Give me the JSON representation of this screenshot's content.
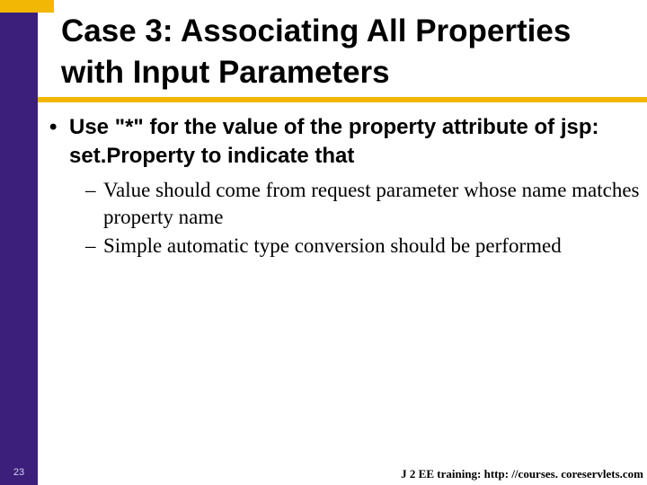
{
  "title": "Case 3: Associating All Properties with Input Parameters",
  "bullets": [
    {
      "text": "Use \"*\" for the value of the property attribute of jsp: set.Property to indicate that",
      "children": [
        "Value should come from request parameter whose name matches property name",
        "Simple automatic type conversion should be performed"
      ]
    }
  ],
  "pageNumber": "23",
  "footer": "J 2 EE training: http: //courses. coreservlets.com"
}
